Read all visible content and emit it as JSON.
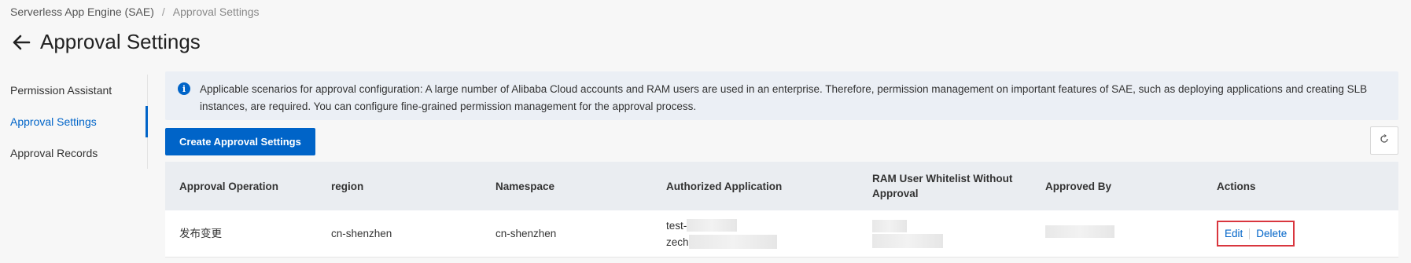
{
  "breadcrumb": {
    "root": "Serverless App Engine (SAE)",
    "separator": "/",
    "current": "Approval Settings"
  },
  "page": {
    "title": "Approval Settings"
  },
  "sidebar": {
    "items": [
      {
        "label": "Permission Assistant",
        "active": false
      },
      {
        "label": "Approval Settings",
        "active": true
      },
      {
        "label": "Approval Records",
        "active": false
      }
    ]
  },
  "notice": {
    "icon": "info-icon",
    "text": "Applicable scenarios for approval configuration: A large number of Alibaba Cloud accounts and RAM users are used in an enterprise. Therefore, permission management on important features of SAE, such as deploying applications and creating SLB instances, are required. You can configure fine-grained permission management for the approval process."
  },
  "toolbar": {
    "create_label": "Create Approval Settings",
    "refresh_icon": "refresh-icon"
  },
  "table": {
    "columns": [
      "Approval Operation",
      "region",
      "Namespace",
      "Authorized Application",
      "RAM User Whitelist Without Approval",
      "Approved By",
      "Actions"
    ],
    "rows": [
      {
        "operation": "发布变更",
        "region": "cn-shenzhen",
        "namespace": "cn-shenzhen",
        "app_line1": "test-",
        "app_line2": "zech",
        "edit_label": "Edit",
        "delete_label": "Delete"
      }
    ]
  },
  "colors": {
    "accent": "#0064c8",
    "highlight_border": "#d9363e",
    "notice_bg": "#ebeff5",
    "header_bg": "#eaedf1"
  }
}
